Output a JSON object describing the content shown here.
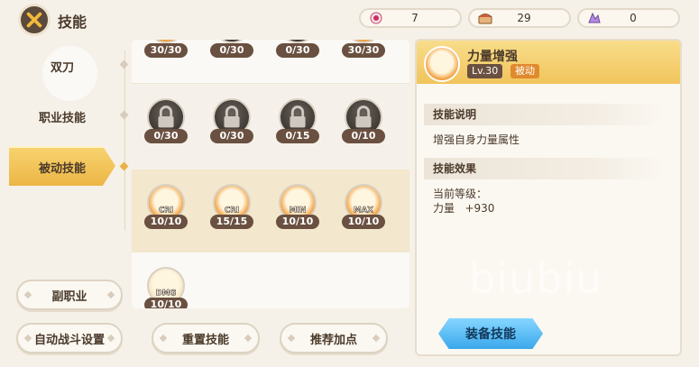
{
  "header": {
    "title": "技能"
  },
  "currencies": [
    {
      "icon": "red-gem-icon",
      "value": "7"
    },
    {
      "icon": "treasure-chest-icon",
      "value": "29"
    },
    {
      "icon": "purple-crystal-icon",
      "value": "0"
    }
  ],
  "sidebar": {
    "tabs": [
      {
        "label": "双刀",
        "active": false
      },
      {
        "label": "职业技能",
        "active": false
      },
      {
        "label": "被动技能",
        "active": true
      }
    ],
    "buttons": {
      "sub_class": "副职业",
      "auto_battle": "自动战斗设置"
    }
  },
  "skills": {
    "rows": [
      [
        {
          "level": "30/30",
          "locked": false,
          "icon": "up-arrow-skill-icon"
        },
        {
          "level": "0/30",
          "locked": true,
          "icon": "locked-skill-icon"
        },
        {
          "level": "0/30",
          "locked": true,
          "icon": "locked-skill-icon"
        },
        {
          "level": "30/30",
          "locked": false,
          "icon": "up-arrow-skill-icon"
        }
      ],
      [
        {
          "level": "0/30",
          "locked": true,
          "icon": "padlock-icon"
        },
        {
          "level": "0/30",
          "locked": true,
          "icon": "padlock-icon"
        },
        {
          "level": "0/15",
          "locked": true,
          "icon": "padlock-icon"
        },
        {
          "level": "0/10",
          "locked": true,
          "icon": "padlock-icon"
        }
      ],
      [
        {
          "level": "10/10",
          "locked": false,
          "icon": "crit-skill-icon",
          "label": "CRI"
        },
        {
          "level": "15/15",
          "locked": false,
          "icon": "crit-damage-skill-icon",
          "label": "CRI"
        },
        {
          "level": "10/10",
          "locked": false,
          "icon": "min-attack-skill-icon",
          "label": "MIN"
        },
        {
          "level": "10/10",
          "locked": false,
          "icon": "max-attack-skill-icon",
          "label": "MAX"
        }
      ],
      [
        {
          "level": "10/10",
          "locked": false,
          "icon": "damage-skill-icon",
          "label": "DMG"
        }
      ]
    ],
    "footer": {
      "reset": "重置技能",
      "recommend": "推荐加点"
    }
  },
  "detail": {
    "name": "力量增强",
    "level": "Lv.30",
    "type": "被动",
    "desc_title": "技能说明",
    "desc": "增强自身力量属性",
    "effect_title": "技能效果",
    "current_level_label": "当前等级：",
    "effect_line": "力量   +930",
    "equip": "装备技能"
  },
  "watermark": "biubiu",
  "colors": {
    "accent": "#f1c45c",
    "badge": "#6a5040",
    "equip": "#3aa8ec"
  }
}
